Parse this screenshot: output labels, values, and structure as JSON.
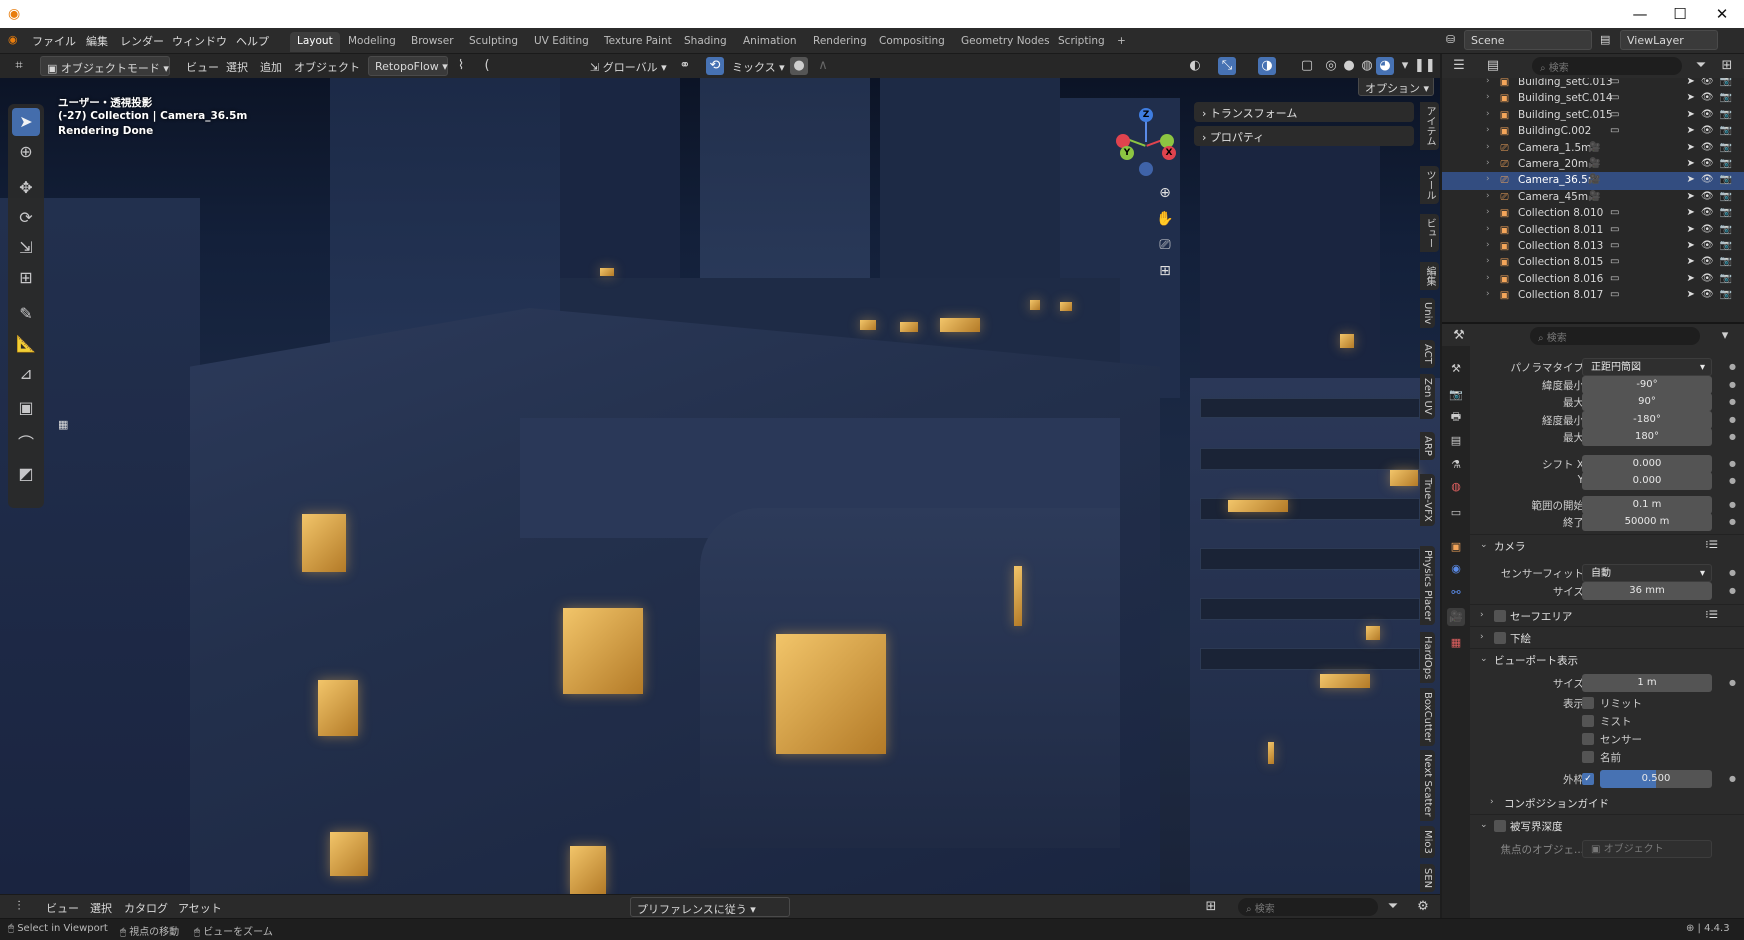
{
  "menu": {
    "items": [
      "ファイル",
      "編集",
      "レンダー",
      "ウィンドウ",
      "ヘルプ"
    ],
    "workspaces": [
      "Layout",
      "Modeling",
      "Browser",
      "Sculpting",
      "UV Editing",
      "Texture Paint",
      "Shading",
      "Animation",
      "Rendering",
      "Compositing",
      "Geometry Nodes",
      "Scripting"
    ],
    "add_tab": "+"
  },
  "scene": {
    "label": "Scene",
    "view_layer": "ViewLayer"
  },
  "viewport_header": {
    "mode": "オブジェクトモード",
    "menus": [
      "ビュー",
      "選択",
      "追加",
      "オブジェクト"
    ],
    "addon": "RetopoFlow",
    "orientation": "グローバル",
    "pivot": "ミックス",
    "options": "オプション"
  },
  "viewport_overlay": {
    "view_name": "ユーザー・透視投影",
    "collection_info": "(-27) Collection | Camera_36.5m",
    "render_status": "Rendering Done"
  },
  "gizmo": {
    "z": "Z",
    "y": "Y",
    "x": "X"
  },
  "npanel": {
    "transform": "トランスフォーム",
    "properties": "プロパティ",
    "tabs": [
      "アイテム",
      "ツール",
      "ビュー",
      "編集",
      "Univ",
      "ACT",
      "Zen UV",
      "ARP",
      "True-VFX",
      "Physics Placer",
      "HardOps",
      "BoxCutter",
      "Next Scatter",
      "Mio3",
      "SEN"
    ]
  },
  "asset_bar": {
    "menus": [
      "ビュー",
      "選択",
      "カタログ",
      "アセット"
    ],
    "import_mode": "プリファレンスに従う",
    "search_placeholder": "検索"
  },
  "status_bar": {
    "select": "Select in Viewport",
    "move": "視点の移動",
    "zoom": "ビューをズーム",
    "version": "4.4.3"
  },
  "outliner": {
    "search_placeholder": "検索",
    "rows": [
      {
        "name": "Building_setC.013",
        "type": "collection",
        "selected": false
      },
      {
        "name": "Building_setC.014",
        "type": "collection",
        "selected": false
      },
      {
        "name": "Building_setC.015",
        "type": "collection",
        "selected": false
      },
      {
        "name": "BuildingC.002",
        "type": "collection",
        "selected": false
      },
      {
        "name": "Camera_1.5m",
        "type": "camera",
        "selected": false
      },
      {
        "name": "Camera_20m",
        "type": "camera",
        "selected": false
      },
      {
        "name": "Camera_36.5m",
        "type": "camera",
        "selected": true
      },
      {
        "name": "Camera_45m",
        "type": "camera",
        "selected": false
      },
      {
        "name": "Collection 8.010",
        "type": "collection",
        "selected": false
      },
      {
        "name": "Collection 8.011",
        "type": "collection",
        "selected": false
      },
      {
        "name": "Collection 8.013",
        "type": "collection",
        "selected": false
      },
      {
        "name": "Collection 8.015",
        "type": "collection",
        "selected": false
      },
      {
        "name": "Collection 8.016",
        "type": "collection",
        "selected": false
      },
      {
        "name": "Collection 8.017",
        "type": "collection",
        "selected": false
      }
    ]
  },
  "properties": {
    "search_placeholder": "検索",
    "panorama_type_label": "パノラマタイプ",
    "panorama_type_value": "正距円筒図",
    "lat_min_label": "緯度最小",
    "lat_min_value": "-90°",
    "lat_max_label": "最大",
    "lat_max_value": "90°",
    "lon_min_label": "経度最小",
    "lon_min_value": "-180°",
    "lon_max_label": "最大",
    "lon_max_value": "180°",
    "shift_x_label": "シフト X",
    "shift_x_value": "0.000",
    "shift_y_label": "Y",
    "shift_y_value": "0.000",
    "clip_start_label": "範囲の開始",
    "clip_start_value": "0.1 m",
    "clip_end_label": "終了",
    "clip_end_value": "50000 m",
    "camera_section": "カメラ",
    "sensor_fit_label": "センサーフィット",
    "sensor_fit_value": "自動",
    "size_label": "サイズ",
    "size_value": "36 mm",
    "safe_area_section": "セーフエリア",
    "background_section": "下絵",
    "viewport_display_section": "ビューポート表示",
    "vd_size_label": "サイズ",
    "vd_size_value": "1 m",
    "show_label": "表示",
    "show_limits": "リミット",
    "show_mist": "ミスト",
    "show_sensor": "センサー",
    "show_name": "名前",
    "passepartout_label": "外枠",
    "passepartout_value": "0.500",
    "passepartout_fraction": 0.5,
    "composition_guides_section": "コンポジションガイド",
    "dof_section": "被写界深度",
    "focus_object_label": "焦点のオブジェ...",
    "focus_object_placeholder": "オブジェクト"
  },
  "colors": {
    "accent": "#4772b3",
    "selection": "#334d80",
    "camera_icon": "#5fb89a",
    "collection_icon": "#f3a55a",
    "window_light": "#f2c56a"
  }
}
